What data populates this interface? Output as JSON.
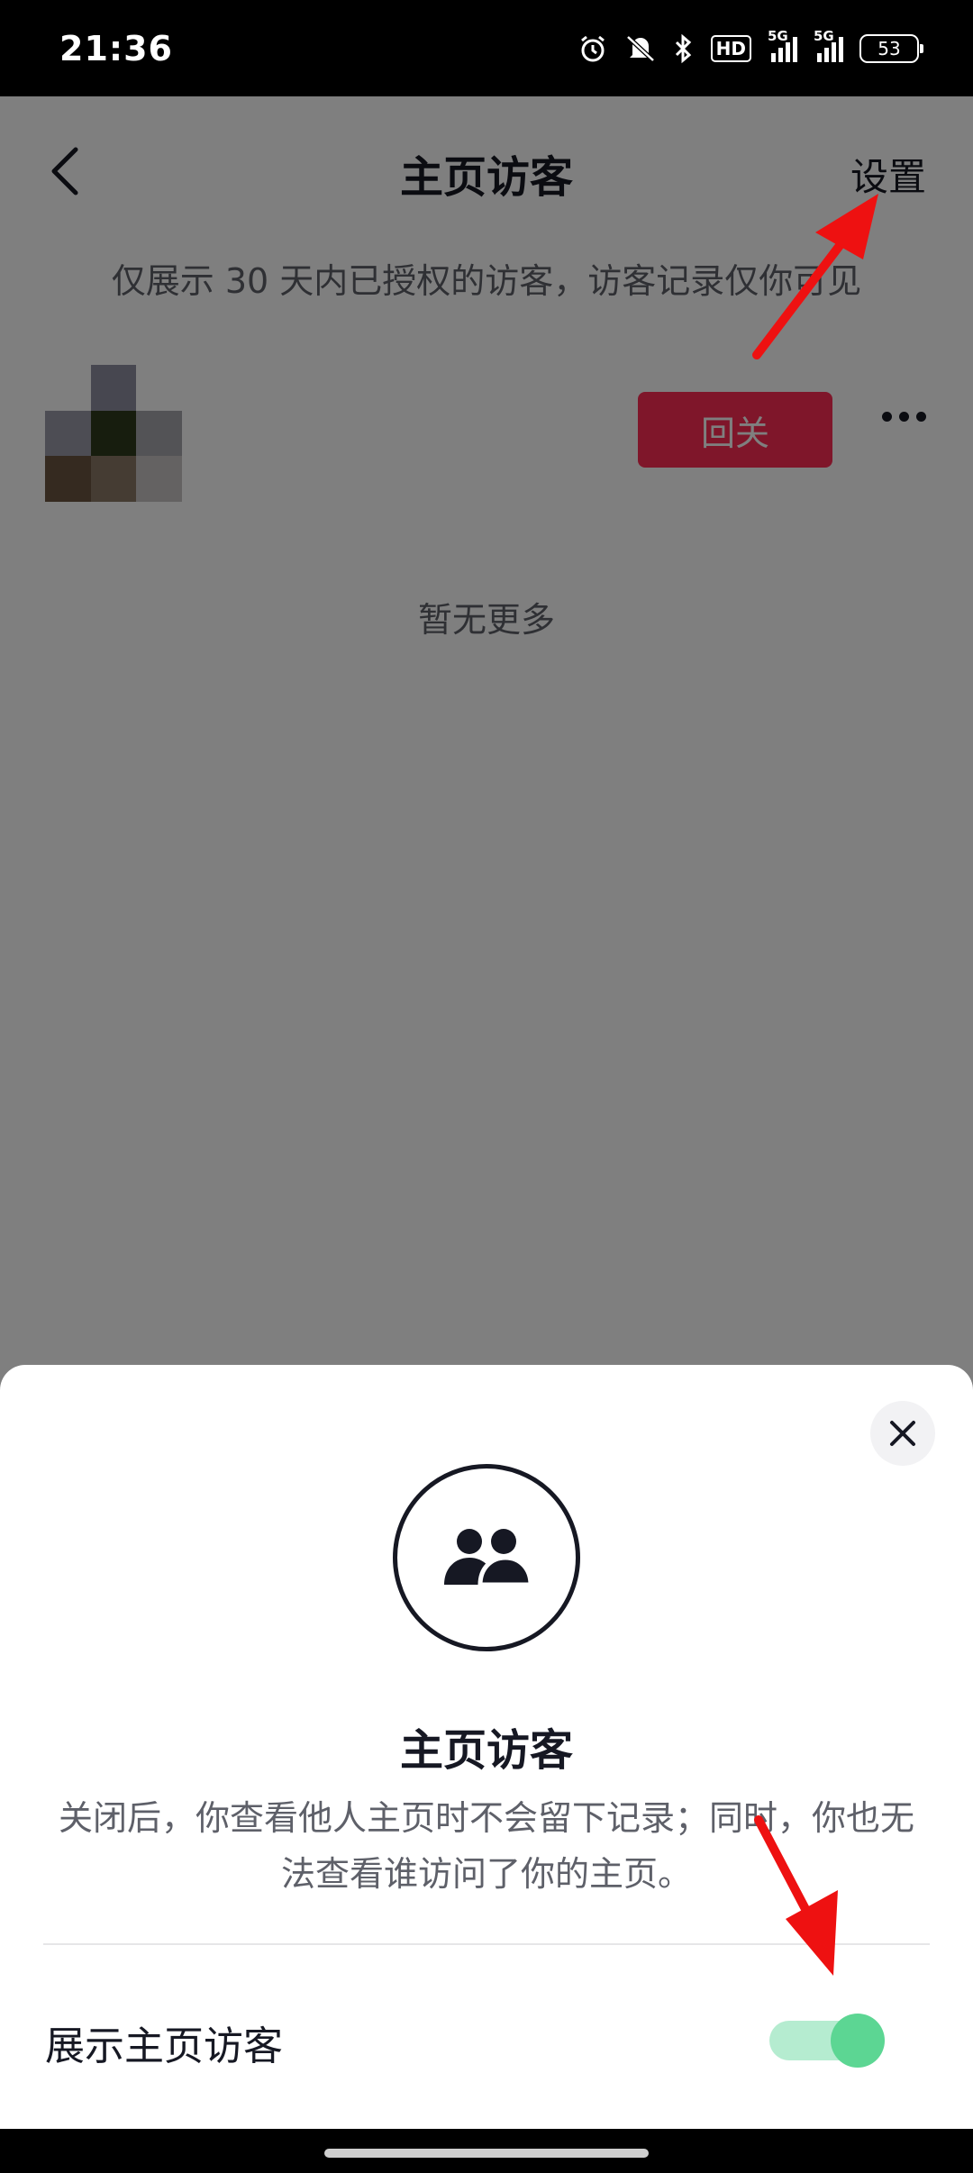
{
  "status_bar": {
    "time": "21:36",
    "icons": [
      "alarm-icon",
      "silent-icon",
      "bluetooth-icon",
      "hd-icon",
      "signal-5g-icon",
      "signal-5g-icon",
      "battery-icon"
    ],
    "hd_label": "HD",
    "network_1": "5G",
    "network_2": "5G",
    "battery": "53"
  },
  "header": {
    "title": "主页访客",
    "settings_label": "设置"
  },
  "notice": "仅展示 30 天内已授权的访客，访客记录仅你可见",
  "visitor": {
    "follow_back_label": "回关"
  },
  "no_more": "暂无更多",
  "sheet": {
    "title": "主页访客",
    "description": "关闭后，你查看他人主页时不会留下记录；同时，你也无法查看谁访问了你的主页。",
    "toggle_label": "展示主页访客",
    "toggle_on": true
  },
  "colors": {
    "accent": "#fe2c55",
    "toggle_on": "#5cd693",
    "annotation": "#ee1111"
  }
}
